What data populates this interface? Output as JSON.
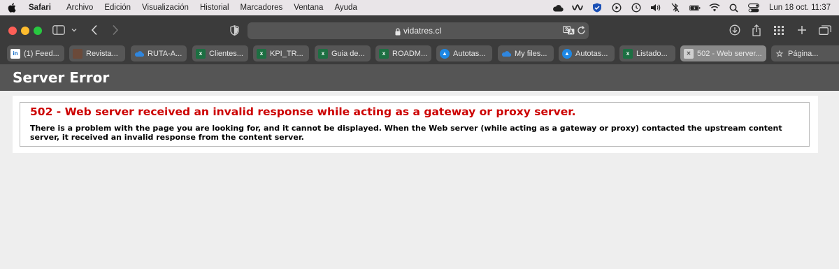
{
  "menubar": {
    "app_name": "Safari",
    "menus": [
      "Archivo",
      "Edición",
      "Visualización",
      "Historial",
      "Marcadores",
      "Ventana",
      "Ayuda"
    ],
    "clock": "Lun 18 oct.  11:37"
  },
  "browser": {
    "url": "vidatres.cl"
  },
  "tabs": [
    {
      "label": "(1) Feed...",
      "favicon": "in"
    },
    {
      "label": "Revista...",
      "favicon": "image"
    },
    {
      "label": "RUTA-A...",
      "favicon": "onedrive"
    },
    {
      "label": "Clientes...",
      "favicon": "excel"
    },
    {
      "label": "KPI_TR...",
      "favicon": "excel"
    },
    {
      "label": "Guia de...",
      "favicon": "excel"
    },
    {
      "label": "ROADM...",
      "favicon": "excel"
    },
    {
      "label": "Autotas...",
      "favicon": "autotask"
    },
    {
      "label": "My files...",
      "favicon": "onedrive"
    },
    {
      "label": "Autotas...",
      "favicon": "autotask"
    },
    {
      "label": "Listado...",
      "favicon": "excel"
    },
    {
      "label": "502 - Web server...",
      "favicon": "error",
      "active": true
    },
    {
      "label": "Página...",
      "favicon": "star"
    }
  ],
  "page": {
    "header_title": "Server Error",
    "error_heading": "502 - Web server received an invalid response while acting as a gateway or proxy server.",
    "error_text": "There is a problem with the page you are looking for, and it cannot be displayed. When the Web server (while acting as a gateway or proxy) contacted the upstream content server, it received an invalid response from the content server."
  },
  "colors": {
    "error_red": "#cc0000",
    "header_bg": "#555555",
    "toolbar_bg": "#3b3b3b"
  }
}
